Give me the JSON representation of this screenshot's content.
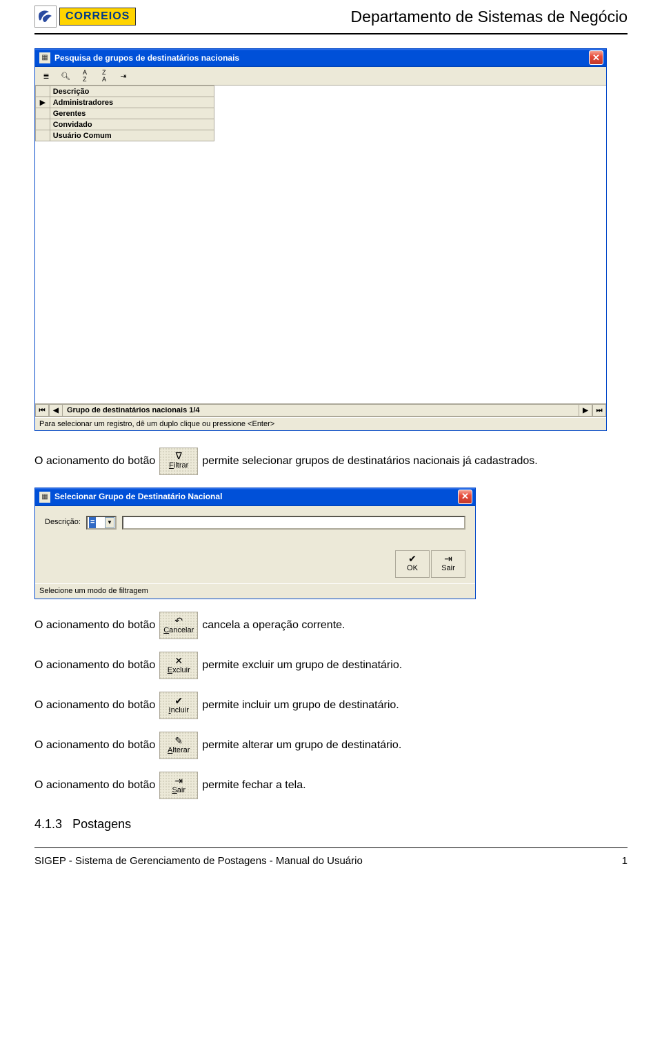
{
  "header": {
    "logo_text": "CORREIOS",
    "department": "Departamento de Sistemas de Negócio"
  },
  "window1": {
    "title": "Pesquisa de grupos de destinatários nacionais",
    "column_header": "Descrição",
    "rows": [
      "Administradores",
      "Gerentes",
      "Convidado",
      "Usuário Comum"
    ],
    "nav_label": "Grupo de destinatários nacionais 1/4",
    "statusbar": "Para selecionar um registro, dê um duplo clique ou pressione <Enter>"
  },
  "paragraphs": {
    "p1_a": "O acionamento do botão",
    "p1_b": "permite selecionar grupos de destinatários nacionais já cadastrados.",
    "p2_a": "O acionamento do botão",
    "p2_b": "cancela a operação corrente.",
    "p3_a": "O acionamento do botão",
    "p3_b": "permite excluir um grupo de destinatário.",
    "p4_a": "O acionamento do botão",
    "p4_b": "permite incluir um grupo de destinatário.",
    "p5_a": "O acionamento do botão",
    "p5_b": "permite alterar um grupo de destinatário.",
    "p6_a": "O acionamento do botão",
    "p6_b": "permite fechar a tela."
  },
  "buttons": {
    "filtrar": "Filtrar",
    "cancelar": "Cancelar",
    "excluir": "Excluir",
    "incluir": "Incluir",
    "alterar": "Alterar",
    "sair": "Sair",
    "ok": "OK"
  },
  "window2": {
    "title": "Selecionar Grupo de Destinatário Nacional",
    "field_label": "Descrição:",
    "dropdown_value": "=",
    "statusbar": "Selecione um modo de filtragem"
  },
  "section": {
    "number": "4.1.3",
    "title": "Postagens"
  },
  "footer": {
    "left": "SIGEP - Sistema de Gerenciamento de Postagens - Manual do Usuário",
    "right": "1"
  }
}
